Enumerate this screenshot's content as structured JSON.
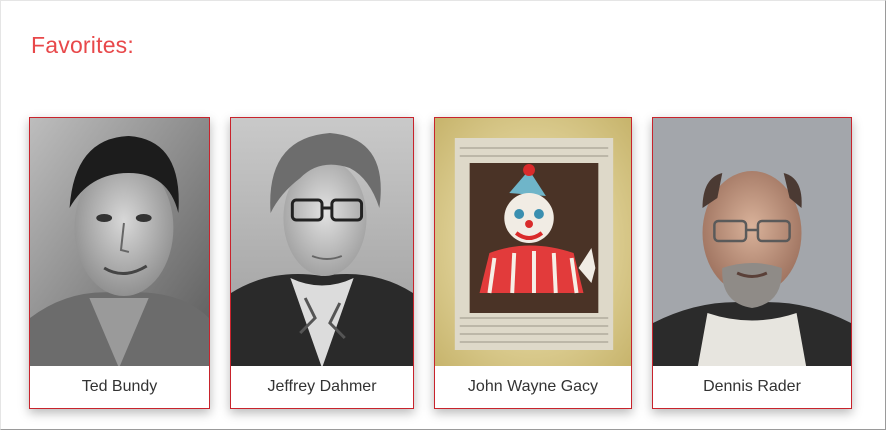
{
  "section": {
    "title": "Favorites:",
    "title_color": "#e8484a",
    "card_border_color": "#c8232c"
  },
  "cards": [
    {
      "name": "Ted Bundy",
      "image": "black-and-white portrait photo"
    },
    {
      "name": "Jeffrey Dahmer",
      "image": "black-and-white yearbook photo with glasses"
    },
    {
      "name": "John Wayne Gacy",
      "image": "clown painting on newspaper"
    },
    {
      "name": "Dennis Rader",
      "image": "color mugshot photo"
    }
  ]
}
